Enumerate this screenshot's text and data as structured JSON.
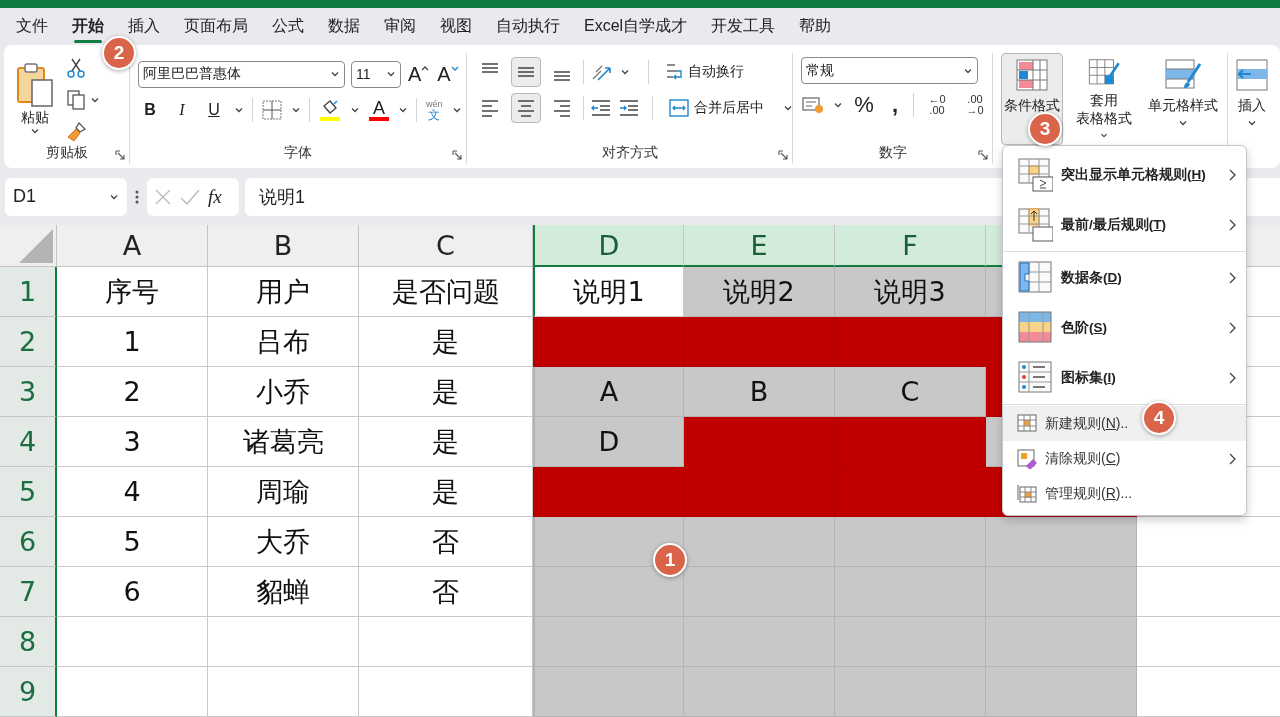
{
  "tabs": [
    {
      "label": "文件",
      "selected": false
    },
    {
      "label": "开始",
      "selected": true
    },
    {
      "label": "插入",
      "selected": false
    },
    {
      "label": "页面布局",
      "selected": false
    },
    {
      "label": "公式",
      "selected": false
    },
    {
      "label": "数据",
      "selected": false
    },
    {
      "label": "审阅",
      "selected": false
    },
    {
      "label": "视图",
      "selected": false
    },
    {
      "label": "自动执行",
      "selected": false
    },
    {
      "label": "Excel自学成才",
      "selected": false
    },
    {
      "label": "开发工具",
      "selected": false
    },
    {
      "label": "帮助",
      "selected": false
    }
  ],
  "clipboard": {
    "title": "剪贴板",
    "paste": "粘贴"
  },
  "font": {
    "title": "字体",
    "font_name": "阿里巴巴普惠体",
    "font_size": "11",
    "size_buttons": [
      "A",
      "A"
    ],
    "style_buttons": [
      "B",
      "I",
      "U"
    ],
    "color_button": "A",
    "phonetic": [
      "wén",
      "文"
    ]
  },
  "alignment": {
    "title": "对齐方式",
    "vertical": [
      {
        "selected": false
      },
      {
        "selected": true
      },
      {
        "selected": false
      }
    ],
    "horizontal": [
      {
        "selected": false
      },
      {
        "selected": true
      },
      {
        "selected": false
      }
    ],
    "wrap_text": "自动换行",
    "merge_center": "合并后居中"
  },
  "number": {
    "title": "数字",
    "format": "常规",
    "percent": "%",
    "comma": ",",
    "decimals": [
      [
        "←0",
        ".00"
      ],
      [
        ".00",
        "→0"
      ]
    ]
  },
  "styles": {
    "buttons": [
      {
        "lines": [
          "条件格式"
        ],
        "pressed": true
      },
      {
        "lines": [
          "套用",
          "表格格式"
        ],
        "pressed": false
      },
      {
        "lines": [
          "单元格样式"
        ],
        "pressed": false
      }
    ]
  },
  "cells": {
    "insert": "插入"
  },
  "formula_bar": {
    "name_box": "D1",
    "fx": "fx",
    "value": "说明1"
  },
  "sheet": {
    "columns": [
      {
        "label": "A",
        "selected": false
      },
      {
        "label": "B",
        "selected": false
      },
      {
        "label": "C",
        "selected": false
      },
      {
        "label": "D",
        "selected": true
      },
      {
        "label": "E",
        "selected": true
      },
      {
        "label": "F",
        "selected": true
      },
      {
        "selected": true
      },
      {
        "selected": false
      }
    ],
    "rows": [
      {
        "label": "1",
        "selected": true,
        "cells": [
          {
            "text": "序号"
          },
          {
            "text": "用户"
          },
          {
            "text": "是否问题"
          },
          {
            "text": "说明1"
          },
          {
            "text": "说明2",
            "color": "#c8c8c8"
          },
          {
            "text": "说明3",
            "color": "#c8c8c8"
          },
          {
            "color": "#c8c8c8"
          }
        ]
      },
      {
        "label": "2",
        "selected": true,
        "cells": [
          {
            "text": "1"
          },
          {
            "text": "吕布"
          },
          {
            "text": "是"
          },
          {
            "color": "#c00000"
          },
          {
            "color": "#c00000"
          },
          {
            "color": "#c00000"
          },
          {
            "color": "#c00000"
          }
        ]
      },
      {
        "label": "3",
        "selected": true,
        "cells": [
          {
            "text": "2"
          },
          {
            "text": "小乔"
          },
          {
            "text": "是"
          },
          {
            "text": "A",
            "color": "#c8c8c8"
          },
          {
            "text": "B",
            "color": "#c8c8c8"
          },
          {
            "text": "C",
            "color": "#c8c8c8"
          },
          {
            "color": "#c00000"
          }
        ]
      },
      {
        "label": "4",
        "selected": true,
        "cells": [
          {
            "text": "3"
          },
          {
            "text": "诸葛亮"
          },
          {
            "text": "是"
          },
          {
            "text": "D",
            "color": "#c8c8c8"
          },
          {
            "color": "#c00000"
          },
          {
            "color": "#c00000"
          },
          {
            "color": "#c8c8c8"
          }
        ]
      },
      {
        "label": "5",
        "selected": true,
        "cells": [
          {
            "text": "4"
          },
          {
            "text": "周瑜"
          },
          {
            "text": "是"
          },
          {
            "color": "#c00000"
          },
          {
            "color": "#c00000"
          },
          {
            "color": "#c00000"
          },
          {
            "color": "#c00000"
          }
        ]
      },
      {
        "label": "6",
        "selected": true,
        "cells": [
          {
            "text": "5"
          },
          {
            "text": "大乔"
          },
          {
            "text": "否"
          },
          {
            "color": "#c8c8c8"
          },
          {
            "color": "#c8c8c8"
          },
          {
            "color": "#c8c8c8"
          },
          {
            "color": "#c8c8c8"
          }
        ]
      },
      {
        "label": "7",
        "selected": true,
        "cells": [
          {
            "text": "6"
          },
          {
            "text": "貂蝉"
          },
          {
            "text": "否"
          },
          {
            "color": "#c8c8c8"
          },
          {
            "color": "#c8c8c8"
          },
          {
            "color": "#c8c8c8"
          },
          {
            "color": "#c8c8c8"
          }
        ]
      },
      {
        "label": "8",
        "selected": true,
        "cells": [
          {},
          {},
          {},
          {
            "color": "#c8c8c8"
          },
          {
            "color": "#c8c8c8"
          },
          {
            "color": "#c8c8c8"
          },
          {
            "color": "#c8c8c8"
          }
        ]
      },
      {
        "label": "9",
        "selected": true,
        "cells": [
          {},
          {},
          {},
          {
            "color": "#c8c8c8"
          },
          {
            "color": "#c8c8c8"
          },
          {
            "color": "#c8c8c8"
          },
          {
            "color": "#c8c8c8"
          }
        ]
      }
    ]
  },
  "menu": {
    "groups": [
      [
        {
          "kind": "large",
          "label": "突出显示单元格规则(H)",
          "submenu": true,
          "selected": false
        },
        {
          "kind": "large",
          "label": "最前/最后规则(T)",
          "submenu": true,
          "selected": false
        }
      ],
      [
        {
          "kind": "large",
          "label": "数据条(D)",
          "submenu": true,
          "selected": false
        },
        {
          "kind": "large",
          "label": "色阶(S)",
          "submenu": true,
          "selected": false
        },
        {
          "kind": "large",
          "label": "图标集(I)",
          "submenu": true,
          "selected": false
        }
      ],
      [
        {
          "kind": "small",
          "label": "新建规则(N)..",
          "submenu": false,
          "selected": true
        },
        {
          "kind": "small",
          "label": "清除规则(C)",
          "submenu": true,
          "selected": false
        },
        {
          "kind": "small",
          "label": "管理规则(R)...",
          "submenu": false,
          "selected": false
        }
      ]
    ]
  },
  "badges": [
    "1",
    "2",
    "3",
    "4"
  ]
}
